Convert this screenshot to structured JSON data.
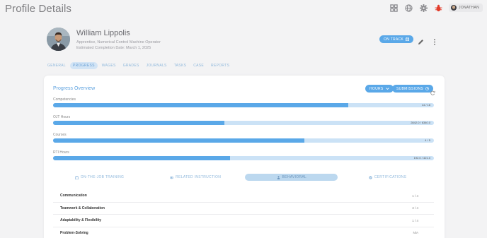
{
  "header": {
    "title": "Profile Details",
    "user_name": "JONATHAN"
  },
  "profile": {
    "name": "William Lippolis",
    "role": "Apprentice, Numerical Control Machine Operator",
    "completion": "Estimated Completion Date: March 1, 2025",
    "status_label": "ON TRACK"
  },
  "tabs": [
    {
      "label": "GENERAL"
    },
    {
      "label": "PROGRESS"
    },
    {
      "label": "WAGES"
    },
    {
      "label": "GRADES"
    },
    {
      "label": "JOURNALS"
    },
    {
      "label": "TASKS"
    },
    {
      "label": "CASE"
    },
    {
      "label": "REPORTS"
    }
  ],
  "active_tab": "PROGRESS",
  "overview": {
    "title": "Progress Overview",
    "hours_label": "HOURS",
    "submissions_label": "SUBMISSIONS"
  },
  "progress": [
    {
      "label": "Competencies",
      "value_text": "14 / 18",
      "fraction": 0.776
    },
    {
      "label": "OJT Hours",
      "value_text": "2842.0 / 6340.0",
      "fraction": 0.45
    },
    {
      "label": "Courses",
      "value_text": "4 / 5",
      "fraction": 0.66
    },
    {
      "label": "RTI Hours",
      "value_text": "192.0 / 421.0",
      "fraction": 0.465
    }
  ],
  "subtabs": [
    {
      "label": "ON-THE-JOB TRAINING"
    },
    {
      "label": "RELATED INSTRUCTION"
    },
    {
      "label": "BEHAVIORAL"
    },
    {
      "label": "CERTIFICATIONS"
    }
  ],
  "active_subtab": "BEHAVIORAL",
  "behavioral": [
    {
      "name": "Communication",
      "value": "1 / 4"
    },
    {
      "name": "Teamwork & Collaboration",
      "value": "3 / 4"
    },
    {
      "name": "Adaptability & Flexibility",
      "value": "1 / 4"
    },
    {
      "name": "Problem-Solving",
      "value": "N/A"
    }
  ],
  "colors": {
    "accent": "#5aa8e8",
    "bar_track": "#cbe2f6",
    "notification": "#e23c2b"
  }
}
